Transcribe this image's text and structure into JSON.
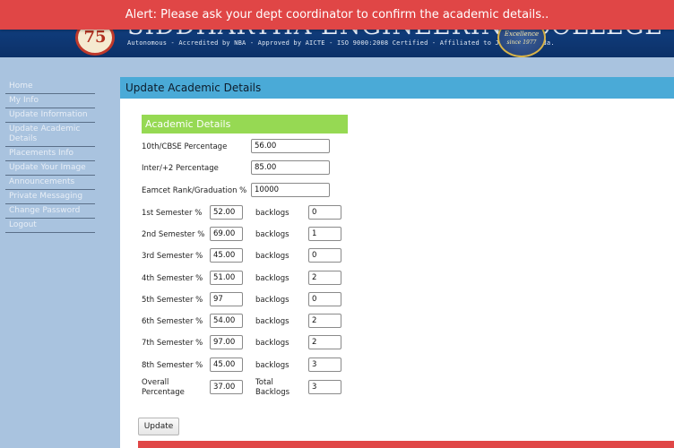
{
  "header": {
    "college_name": "SIDDHARTHA ENGINEERING COLLEGE",
    "tagline": "Autonomous - Accredited by NBA - Approved by AICTE - ISO 9000:2008 Certified - Affiliated to JNTUK,Kakinada.",
    "logo_number": "75",
    "seal_line1": "Excellence",
    "seal_line2": "since 1977"
  },
  "alert": {
    "message": "Alert: Please ask your dept coordinator to confirm the academic details.."
  },
  "sidebar": {
    "items": [
      {
        "label": "Home"
      },
      {
        "label": "My Info"
      },
      {
        "label": "Update Information"
      },
      {
        "label": "Update Academic Details"
      },
      {
        "label": "Placements Info"
      },
      {
        "label": "Update Your Image"
      },
      {
        "label": "Announcements"
      },
      {
        "label": "Private Messaging"
      },
      {
        "label": "Change Password"
      },
      {
        "label": "Logout"
      }
    ]
  },
  "main": {
    "title": "Update Academic Details",
    "section_title": "Academic Details",
    "fields": [
      {
        "label": "10th/CBSE Percentage",
        "value": "56.00"
      },
      {
        "label": "Inter/+2 Percentage",
        "value": "85.00"
      },
      {
        "label": "Eamcet Rank/Graduation %",
        "value": "10000"
      }
    ],
    "backlogs_label": "backlogs",
    "semesters": [
      {
        "label": "1st Semester %",
        "percent": "52.00",
        "backlogs": "0"
      },
      {
        "label": "2nd Semester %",
        "percent": "69.00",
        "backlogs": "1"
      },
      {
        "label": "3rd Semester %",
        "percent": "45.00",
        "backlogs": "0"
      },
      {
        "label": "4th Semester %",
        "percent": "51.00",
        "backlogs": "2"
      },
      {
        "label": "5th Semester %",
        "percent": "97",
        "backlogs": "0"
      },
      {
        "label": "6th Semester %",
        "percent": "54.00",
        "backlogs": "2"
      },
      {
        "label": "7th Semester %",
        "percent": "97.00",
        "backlogs": "2"
      },
      {
        "label": "8th Semester %",
        "percent": "45.00",
        "backlogs": "3"
      }
    ],
    "overall": {
      "label_line1": "Overall",
      "label_line2": "Percentage",
      "value": "37.00",
      "total_line1": "Total",
      "total_line2": "Backlogs",
      "total_value": "3"
    },
    "update_label": "Update"
  },
  "colors": {
    "alert": "#e04646",
    "title_bar": "#4aaad7",
    "section_bar": "#96d953",
    "sidebar_bg": "#a9c3df"
  }
}
